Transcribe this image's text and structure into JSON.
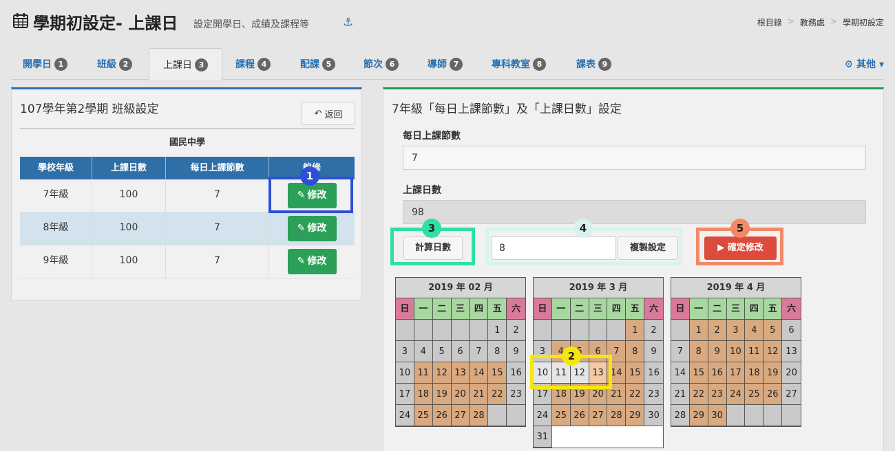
{
  "header": {
    "title": "學期初設定- 上課日",
    "subtitle": "設定開學日、成績及課程等",
    "anchor_icon": "anchor-icon",
    "breadcrumb": [
      "根目錄",
      "教務處",
      "學期初設定"
    ]
  },
  "tabs": [
    {
      "label": "開學日",
      "badge": "1"
    },
    {
      "label": "班級",
      "badge": "2"
    },
    {
      "label": "上課日",
      "badge": "3"
    },
    {
      "label": "課程",
      "badge": "4"
    },
    {
      "label": "配課",
      "badge": "5"
    },
    {
      "label": "節次",
      "badge": "6"
    },
    {
      "label": "導師",
      "badge": "7"
    },
    {
      "label": "專科教室",
      "badge": "8"
    },
    {
      "label": "課表",
      "badge": "9"
    }
  ],
  "other_menu": "其他",
  "left_panel": {
    "title": "107學年第2學期 班級設定",
    "back_label": "返回",
    "caption": "國民中學",
    "columns": [
      "學校年級",
      "上課日數",
      "每日上課節數",
      "編修"
    ],
    "rows": [
      {
        "grade": "7年級",
        "days": "100",
        "periods": "7",
        "action": "修改"
      },
      {
        "grade": "8年級",
        "days": "100",
        "periods": "7",
        "action": "修改"
      },
      {
        "grade": "9年級",
        "days": "100",
        "periods": "7",
        "action": "修改"
      }
    ]
  },
  "right_panel": {
    "title": "7年級「每日上課節數」及「上課日數」設定",
    "periods_label": "每日上課節數",
    "periods_value": "7",
    "days_label": "上課日數",
    "days_value": "98",
    "calc_button": "計算日數",
    "copy_value": "8",
    "copy_button": "複製設定",
    "confirm_button": "確定修改"
  },
  "calendars": [
    {
      "title": "2019 年 02 月",
      "weekdays": [
        "日",
        "一",
        "二",
        "三",
        "四",
        "五",
        "六"
      ],
      "cells": [
        [
          "",
          "g"
        ],
        [
          "",
          "g"
        ],
        [
          "",
          "g"
        ],
        [
          "",
          "g"
        ],
        [
          "",
          "g"
        ],
        [
          "1",
          "g"
        ],
        [
          "2",
          "g"
        ],
        [
          "3",
          "g"
        ],
        [
          "4",
          "g"
        ],
        [
          "5",
          "g"
        ],
        [
          "6",
          "g"
        ],
        [
          "7",
          "g"
        ],
        [
          "8",
          "g"
        ],
        [
          "9",
          "g"
        ],
        [
          "10",
          "g"
        ],
        [
          "11",
          "o"
        ],
        [
          "12",
          "o"
        ],
        [
          "13",
          "o"
        ],
        [
          "14",
          "o"
        ],
        [
          "15",
          "o"
        ],
        [
          "16",
          "g"
        ],
        [
          "17",
          "g"
        ],
        [
          "18",
          "o"
        ],
        [
          "19",
          "o"
        ],
        [
          "20",
          "o"
        ],
        [
          "21",
          "o"
        ],
        [
          "22",
          "o"
        ],
        [
          "23",
          "g"
        ],
        [
          "24",
          "g"
        ],
        [
          "25",
          "o"
        ],
        [
          "26",
          "o"
        ],
        [
          "27",
          "o"
        ],
        [
          "28",
          "o"
        ],
        [
          "",
          "g"
        ],
        [
          "",
          "g"
        ]
      ]
    },
    {
      "title": "2019 年 3 月",
      "weekdays": [
        "日",
        "一",
        "二",
        "三",
        "四",
        "五",
        "六"
      ],
      "cells": [
        [
          "",
          "g"
        ],
        [
          "",
          "g"
        ],
        [
          "",
          "g"
        ],
        [
          "",
          "g"
        ],
        [
          "",
          "g"
        ],
        [
          "1",
          "o"
        ],
        [
          "2",
          "g"
        ],
        [
          "3",
          "g"
        ],
        [
          "4",
          "o"
        ],
        [
          "5",
          "o"
        ],
        [
          "6",
          "o"
        ],
        [
          "7",
          "o"
        ],
        [
          "8",
          "o"
        ],
        [
          "9",
          "g"
        ],
        [
          "10",
          "w"
        ],
        [
          "11",
          "w"
        ],
        [
          "12",
          "w"
        ],
        [
          "13",
          "p"
        ],
        [
          "14",
          "o"
        ],
        [
          "15",
          "o"
        ],
        [
          "16",
          "g"
        ],
        [
          "17",
          "g"
        ],
        [
          "18",
          "o"
        ],
        [
          "19",
          "o"
        ],
        [
          "20",
          "o"
        ],
        [
          "21",
          "o"
        ],
        [
          "22",
          "o"
        ],
        [
          "23",
          "g"
        ],
        [
          "24",
          "g"
        ],
        [
          "25",
          "o"
        ],
        [
          "26",
          "o"
        ],
        [
          "27",
          "o"
        ],
        [
          "28",
          "o"
        ],
        [
          "29",
          "o"
        ],
        [
          "30",
          "g"
        ],
        [
          "31",
          "g"
        ]
      ]
    },
    {
      "title": "2019 年 4 月",
      "weekdays": [
        "日",
        "一",
        "二",
        "三",
        "四",
        "五",
        "六"
      ],
      "cells": [
        [
          "",
          "g"
        ],
        [
          "1",
          "o"
        ],
        [
          "2",
          "o"
        ],
        [
          "3",
          "o"
        ],
        [
          "4",
          "o"
        ],
        [
          "5",
          "o"
        ],
        [
          "6",
          "g"
        ],
        [
          "7",
          "g"
        ],
        [
          "8",
          "o"
        ],
        [
          "9",
          "o"
        ],
        [
          "10",
          "o"
        ],
        [
          "11",
          "o"
        ],
        [
          "12",
          "o"
        ],
        [
          "13",
          "g"
        ],
        [
          "14",
          "g"
        ],
        [
          "15",
          "o"
        ],
        [
          "16",
          "o"
        ],
        [
          "17",
          "o"
        ],
        [
          "18",
          "o"
        ],
        [
          "19",
          "o"
        ],
        [
          "20",
          "g"
        ],
        [
          "21",
          "g"
        ],
        [
          "22",
          "o"
        ],
        [
          "23",
          "o"
        ],
        [
          "24",
          "o"
        ],
        [
          "25",
          "o"
        ],
        [
          "26",
          "o"
        ],
        [
          "27",
          "g"
        ],
        [
          "28",
          "g"
        ],
        [
          "29",
          "o"
        ],
        [
          "30",
          "o"
        ],
        [
          "",
          "g"
        ],
        [
          "",
          "g"
        ],
        [
          "",
          "g"
        ],
        [
          "",
          "g"
        ]
      ]
    }
  ],
  "annotations": {
    "labels": [
      "1",
      "2",
      "3",
      "4",
      "5"
    ],
    "colors": {
      "a1": "#2d4fd6",
      "a2": "#f4e80a",
      "a3": "#2fe0a0",
      "a4": "#d8f3ee",
      "a5": "#f28a68"
    }
  }
}
